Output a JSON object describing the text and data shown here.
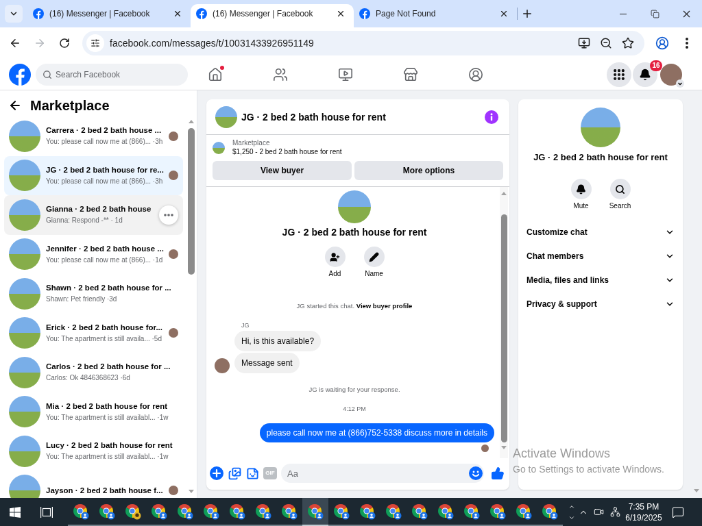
{
  "browser": {
    "tabs": [
      {
        "title": "(16) Messenger | Facebook",
        "selected": false
      },
      {
        "title": "(16) Messenger | Facebook",
        "selected": true
      },
      {
        "title": "Page Not Found",
        "selected": false
      }
    ],
    "url": "facebook.com/messages/t/10031433926951149"
  },
  "nav": {
    "search_placeholder": "Search Facebook",
    "items": [
      {
        "kind": "home",
        "selected": false,
        "dot": true
      },
      {
        "kind": "friends",
        "selected": false,
        "dot": false
      },
      {
        "kind": "video",
        "selected": false,
        "dot": false
      },
      {
        "kind": "marketplace",
        "selected": false,
        "dot": false
      },
      {
        "kind": "groups",
        "selected": false,
        "dot": false
      }
    ],
    "notification_count": "16"
  },
  "sidebar": {
    "title": "Marketplace",
    "conversations": [
      {
        "title": "Carrera · 2 bed 2 bath house ...",
        "subtitle": "You: please call now me at (866)... ·3h",
        "selected": false,
        "hovered": false,
        "seen": true
      },
      {
        "title": "JG · 2 bed 2 bath house for re...",
        "subtitle": "You: please call now me at (866)... ·3h",
        "selected": true,
        "hovered": false,
        "seen": true
      },
      {
        "title": "Gianna · 2 bed 2 bath house",
        "subtitle": "Gianna: Respond -** · 1d",
        "selected": false,
        "hovered": true
      },
      {
        "title": "Jennifer · 2 bed 2 bath house ...",
        "subtitle": "You: please call now me at (866)... ·1d",
        "selected": false,
        "hovered": false,
        "seen": true
      },
      {
        "title": "Shawn · 2 bed 2 bath house for ...",
        "subtitle": "Shawn: Pet friendly ·3d",
        "selected": false,
        "hovered": false,
        "seen": false
      },
      {
        "title": "Erick · 2 bed 2 bath house for...",
        "subtitle": "You: The apartment is still availa... ·5d",
        "selected": false,
        "hovered": false,
        "seen": true
      },
      {
        "title": "Carlos · 2 bed 2 bath house for ...",
        "subtitle": "Carlos: Ok 4846368623 ·6d",
        "selected": false,
        "hovered": false,
        "seen": false
      },
      {
        "title": "Mia · 2 bed 2 bath house for rent",
        "subtitle": "You: The apartment is still availabl... ·1w",
        "selected": false,
        "hovered": false,
        "seen": false
      },
      {
        "title": "Lucy · 2 bed 2 bath house for rent",
        "subtitle": "You: The apartment is still availabl... ·1w",
        "selected": false,
        "hovered": false,
        "seen": false
      },
      {
        "title": "Jayson · 2 bed 2 bath house f...",
        "selected": false,
        "hovered": false,
        "seen": true
      }
    ]
  },
  "chat": {
    "title": "JG · 2 bed 2 bath house for rent",
    "listing": {
      "source": "Marketplace",
      "summary": "$1,250 - 2 bed 2 bath house for rent"
    },
    "actions": [
      "View buyer",
      "More options"
    ],
    "intro": {
      "title": "JG · 2 bed 2 bath house for rent",
      "actions": [
        {
          "kind": "add",
          "label": "Add"
        },
        {
          "kind": "name",
          "label": "Name"
        }
      ]
    },
    "messages": [
      {
        "kind": "notice",
        "text": "JG started this chat.",
        "link": "View buyer profile"
      },
      {
        "kind": "sender",
        "text": "JG"
      },
      {
        "kind": "incoming",
        "text": "Hi, is this available?",
        "avatar": false
      },
      {
        "kind": "incoming",
        "text": "Message sent",
        "avatar": true
      },
      {
        "kind": "notice",
        "text": "JG is waiting for your response."
      },
      {
        "kind": "time",
        "text": "4:12 PM"
      },
      {
        "kind": "outgoing",
        "text": "please call now me at (866)752-5338 discuss more in details",
        "seen": true
      }
    ],
    "composer": {
      "placeholder": "Aa",
      "gif_label": "GIF"
    }
  },
  "details": {
    "title": "JG · 2 bed 2 bath house for rent",
    "actions": [
      {
        "kind": "mute",
        "label": "Mute"
      },
      {
        "kind": "search",
        "label": "Search"
      }
    ],
    "sections": [
      {
        "label": "Customize chat",
        "expanded": false
      },
      {
        "label": "Chat members",
        "expanded": false
      },
      {
        "label": "Media, files and links",
        "expanded": false
      },
      {
        "label": "Privacy & support",
        "expanded": false
      }
    ]
  },
  "system_notice": {
    "title": "Activate Windows",
    "subtitle": "Go to Settings to activate Windows."
  },
  "taskbar": {
    "apps": [
      {
        "kind": "browser",
        "selected": false
      },
      {
        "kind": "browser",
        "selected": false
      },
      {
        "kind": "browser_photo",
        "selected": false
      },
      {
        "kind": "browser",
        "selected": false
      },
      {
        "kind": "browser",
        "selected": false
      },
      {
        "kind": "browser",
        "selected": false
      },
      {
        "kind": "browser",
        "selected": false
      },
      {
        "kind": "browser",
        "selected": false
      },
      {
        "kind": "browser",
        "selected": false
      },
      {
        "kind": "browser",
        "selected": true
      },
      {
        "kind": "browser",
        "selected": false
      },
      {
        "kind": "browser",
        "selected": false
      },
      {
        "kind": "browser",
        "selected": false
      },
      {
        "kind": "browser",
        "selected": false
      },
      {
        "kind": "browser",
        "selected": false
      },
      {
        "kind": "browser",
        "selected": false
      },
      {
        "kind": "browser",
        "selected": false
      },
      {
        "kind": "browser",
        "selected": false
      },
      {
        "kind": "browser",
        "selected": false
      }
    ],
    "time": "7:35 PM",
    "date": "6/19/2025"
  }
}
